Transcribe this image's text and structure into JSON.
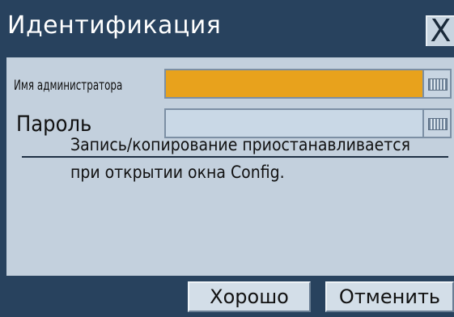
{
  "dialog": {
    "title": "Идентификация",
    "close_label": "X"
  },
  "form": {
    "admin_label": "Имя администратора",
    "admin_value": "",
    "password_label": "Пароль",
    "password_value": ""
  },
  "message": {
    "line1": "Запись/копирование приостанавливается",
    "line2": "при открытии окна Config."
  },
  "buttons": {
    "ok_label": "Хорошо",
    "cancel_label": "Отменить"
  },
  "colors": {
    "title_bar": "#28425e",
    "panel": "#c3d0dd",
    "active_field": "#e8a21c",
    "inactive_field": "#c9d8e6"
  },
  "icons": {
    "close": "close-icon",
    "keyboard": "keyboard-icon"
  }
}
